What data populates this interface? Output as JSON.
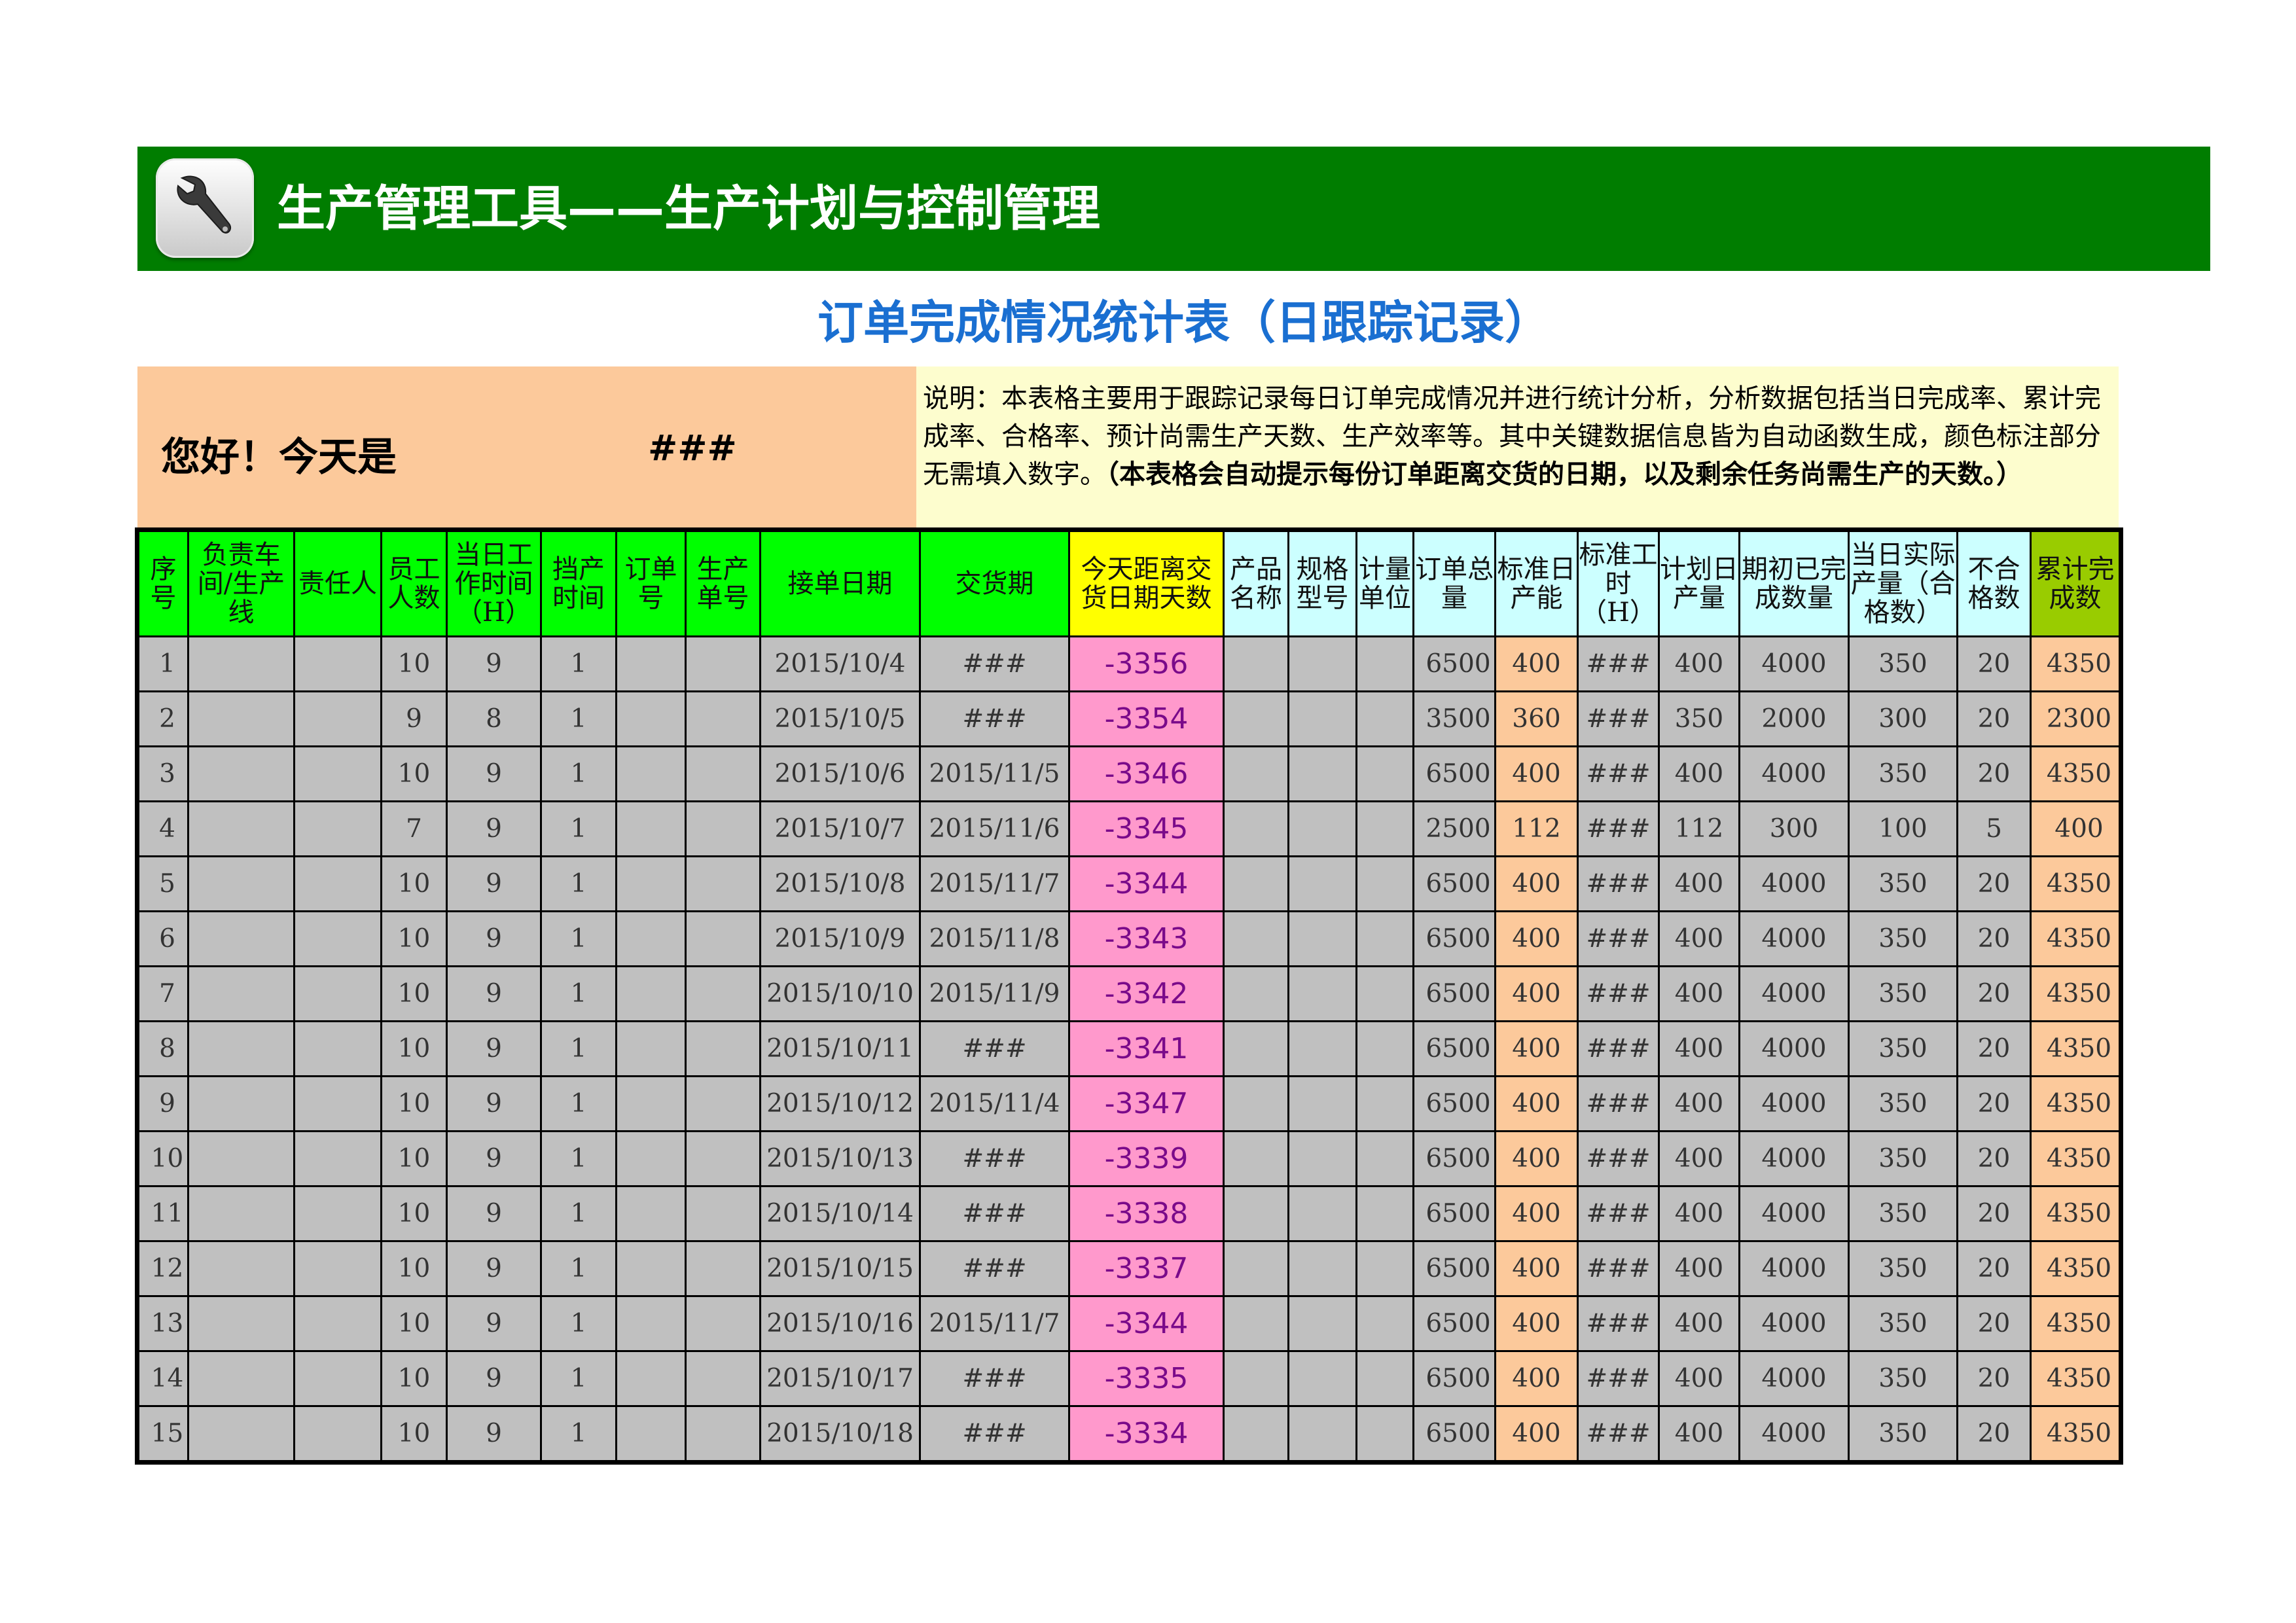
{
  "banner": {
    "icon": "wrench-icon",
    "title": "生产管理工具——生产计划与控制管理"
  },
  "sheet_title": "订单完成情况统计表（日跟踪记录）",
  "greeting": {
    "label": "您好！今天是",
    "date": "###"
  },
  "note": {
    "text": "说明：本表格主要用于跟踪记录每日订单完成情况并进行统计分析，分析数据包括当日完成率、累计完成率、合格率、预计尚需生产天数、生产效率等。其中关键数据信息皆为自动函数生成，颜色标注部分无需填入数字。",
    "bold": "（本表格会自动提示每份订单距离交货的日期，以及剩余任务尚需生产的天数。）"
  },
  "colors": {
    "banner": "#007d00",
    "title": "#1a6fd1",
    "greeting_bg": "#fcc99b",
    "note_bg": "#fdfdce",
    "header_green": "#00ff00",
    "header_yellow": "#ffff00",
    "header_cyan": "#ccffff",
    "header_olive": "#99cc00",
    "cell_gray": "#c0c0c0",
    "cell_orange": "#fcc99b",
    "cell_pink": "#ff99cc"
  },
  "table": {
    "headers": [
      "序号",
      "负责车间/生产线",
      "责任人",
      "员工人数",
      "当日工作时间（H）",
      "挡产时间",
      "订单号",
      "生产单号",
      "接单日期",
      "交货期",
      "今天距离交货日期天数",
      "产品名称",
      "规格型号",
      "计量单位",
      "订单总量",
      "标准日产能",
      "标准工时（H）",
      "计划日产量",
      "期初已完成数量",
      "当日实际产量（合格数）",
      "不合格数",
      "累计完成数"
    ],
    "rows": [
      [
        "1",
        "",
        "",
        "10",
        "9",
        "1",
        "",
        "",
        "2015/10/4",
        "###",
        "-3356",
        "",
        "",
        "",
        "6500",
        "400",
        "###",
        "400",
        "4000",
        "350",
        "20",
        "4350"
      ],
      [
        "2",
        "",
        "",
        "9",
        "8",
        "1",
        "",
        "",
        "2015/10/5",
        "###",
        "-3354",
        "",
        "",
        "",
        "3500",
        "360",
        "###",
        "350",
        "2000",
        "300",
        "20",
        "2300"
      ],
      [
        "3",
        "",
        "",
        "10",
        "9",
        "1",
        "",
        "",
        "2015/10/6",
        "2015/11/5",
        "-3346",
        "",
        "",
        "",
        "6500",
        "400",
        "###",
        "400",
        "4000",
        "350",
        "20",
        "4350"
      ],
      [
        "4",
        "",
        "",
        "7",
        "9",
        "1",
        "",
        "",
        "2015/10/7",
        "2015/11/6",
        "-3345",
        "",
        "",
        "",
        "2500",
        "112",
        "###",
        "112",
        "300",
        "100",
        "5",
        "400"
      ],
      [
        "5",
        "",
        "",
        "10",
        "9",
        "1",
        "",
        "",
        "2015/10/8",
        "2015/11/7",
        "-3344",
        "",
        "",
        "",
        "6500",
        "400",
        "###",
        "400",
        "4000",
        "350",
        "20",
        "4350"
      ],
      [
        "6",
        "",
        "",
        "10",
        "9",
        "1",
        "",
        "",
        "2015/10/9",
        "2015/11/8",
        "-3343",
        "",
        "",
        "",
        "6500",
        "400",
        "###",
        "400",
        "4000",
        "350",
        "20",
        "4350"
      ],
      [
        "7",
        "",
        "",
        "10",
        "9",
        "1",
        "",
        "",
        "2015/10/10",
        "2015/11/9",
        "-3342",
        "",
        "",
        "",
        "6500",
        "400",
        "###",
        "400",
        "4000",
        "350",
        "20",
        "4350"
      ],
      [
        "8",
        "",
        "",
        "10",
        "9",
        "1",
        "",
        "",
        "2015/10/11",
        "###",
        "-3341",
        "",
        "",
        "",
        "6500",
        "400",
        "###",
        "400",
        "4000",
        "350",
        "20",
        "4350"
      ],
      [
        "9",
        "",
        "",
        "10",
        "9",
        "1",
        "",
        "",
        "2015/10/12",
        "2015/11/4",
        "-3347",
        "",
        "",
        "",
        "6500",
        "400",
        "###",
        "400",
        "4000",
        "350",
        "20",
        "4350"
      ],
      [
        "10",
        "",
        "",
        "10",
        "9",
        "1",
        "",
        "",
        "2015/10/13",
        "###",
        "-3339",
        "",
        "",
        "",
        "6500",
        "400",
        "###",
        "400",
        "4000",
        "350",
        "20",
        "4350"
      ],
      [
        "11",
        "",
        "",
        "10",
        "9",
        "1",
        "",
        "",
        "2015/10/14",
        "###",
        "-3338",
        "",
        "",
        "",
        "6500",
        "400",
        "###",
        "400",
        "4000",
        "350",
        "20",
        "4350"
      ],
      [
        "12",
        "",
        "",
        "10",
        "9",
        "1",
        "",
        "",
        "2015/10/15",
        "###",
        "-3337",
        "",
        "",
        "",
        "6500",
        "400",
        "###",
        "400",
        "4000",
        "350",
        "20",
        "4350"
      ],
      [
        "13",
        "",
        "",
        "10",
        "9",
        "1",
        "",
        "",
        "2015/10/16",
        "2015/11/7",
        "-3344",
        "",
        "",
        "",
        "6500",
        "400",
        "###",
        "400",
        "4000",
        "350",
        "20",
        "4350"
      ],
      [
        "14",
        "",
        "",
        "10",
        "9",
        "1",
        "",
        "",
        "2015/10/17",
        "###",
        "-3335",
        "",
        "",
        "",
        "6500",
        "400",
        "###",
        "400",
        "4000",
        "350",
        "20",
        "4350"
      ],
      [
        "15",
        "",
        "",
        "10",
        "9",
        "1",
        "",
        "",
        "2015/10/18",
        "###",
        "-3334",
        "",
        "",
        "",
        "6500",
        "400",
        "###",
        "400",
        "4000",
        "350",
        "20",
        "4350"
      ]
    ]
  }
}
